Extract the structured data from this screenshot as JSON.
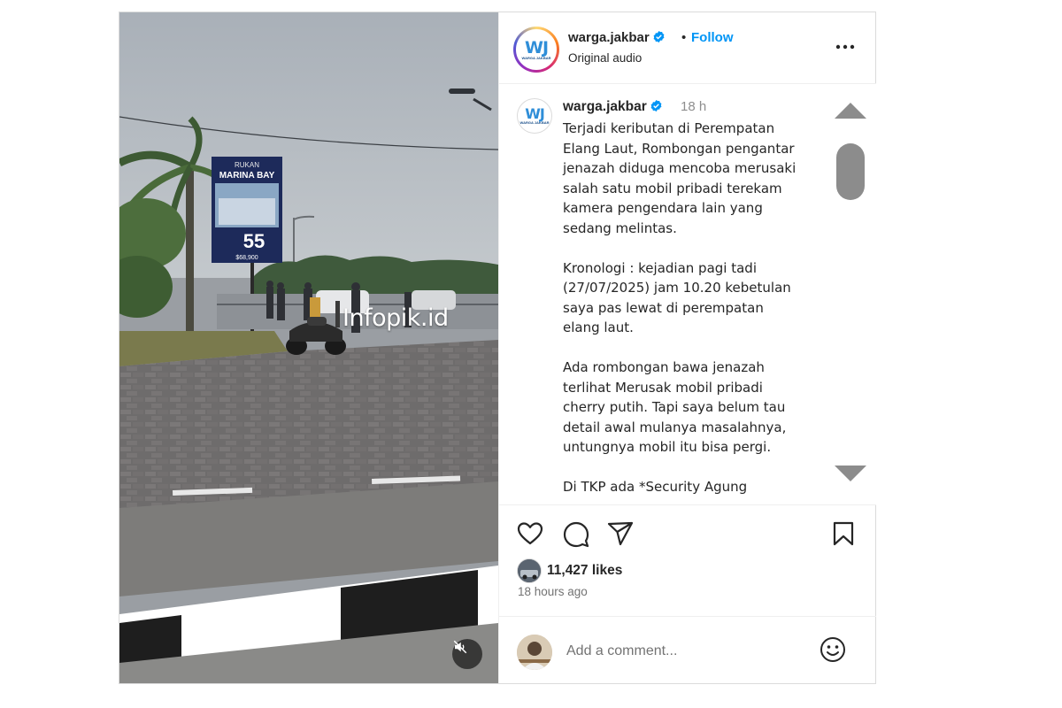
{
  "media": {
    "watermark": "Infopik.id",
    "billboard_brand": "RUKAN",
    "billboard_title": "MARINA BAY",
    "billboard_price": "55",
    "billboard_sub": "$68,900",
    "mute_icon": "speaker-muted-icon"
  },
  "header": {
    "avatar_text": "WJ",
    "avatar_subtext": "WARGA JAKBAR",
    "username": "warga.jakbar",
    "separator": "•",
    "follow_label": "Follow",
    "audio_label": "Original audio",
    "more_icon": "more-horizontal-icon"
  },
  "caption": {
    "avatar_text": "WJ",
    "avatar_subtext": "WARGA JAKBAR",
    "username": "warga.jakbar",
    "time": "18 h",
    "text": "Terjadi keributan di Perempatan\nElang Laut, Rombongan pengantar\njenazah diduga mencoba  merusaki\nsalah satu mobil pribadi terekam\nkamera pengendara lain yang\nsedang melintas.\n\nKronologi : kejadian pagi tadi\n(27/07/2025) jam 10.20 kebetulan\nsaya pas lewat di perempatan\nelang laut.\n\nAda rombongan bawa jenazah\nterlihat Merusak mobil pribadi\ncherry putih. Tapi saya belum tau\ndetail awal mulanya masalahnya,\nuntungnya mobil itu bisa pergi.\n\nDi TKP ada *Security Agung"
  },
  "actions": {
    "like_icon": "heart-icon",
    "comment_icon": "comment-icon",
    "share_icon": "share-icon",
    "save_icon": "bookmark-icon",
    "likes_count": "11,427 likes",
    "posted_ago": "18 hours ago"
  },
  "comment": {
    "placeholder": "Add a comment...",
    "emoji_icon": "smiley-icon"
  },
  "colors": {
    "follow_blue": "#0095f6",
    "verified_blue": "#0095f6",
    "text": "#262626",
    "muted": "#737373",
    "border": "#dbdbdb"
  }
}
